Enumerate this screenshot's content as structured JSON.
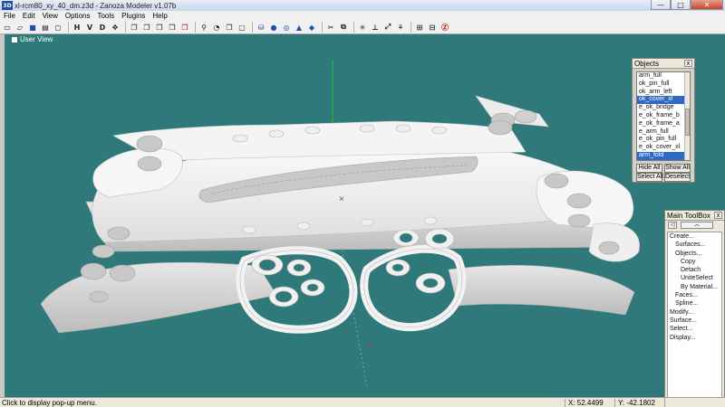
{
  "app": {
    "icon_text": "3D",
    "title": "xl-rcm80_xy_40_dm.z3d - Zanoza Modeler v1.07b",
    "window_controls": {
      "minimize": "—",
      "maximize": "□",
      "close": "✕"
    }
  },
  "menu": [
    "File",
    "Edit",
    "View",
    "Options",
    "Tools",
    "Plugins",
    "Help"
  ],
  "toolbar": {
    "letters": [
      "H",
      "V",
      "D"
    ],
    "icons": [
      "new-icon",
      "open-icon",
      "save-icon",
      "print-icon",
      "hide-icon",
      "view-front-icon",
      "view-side-icon",
      "move-icon",
      "cube-icon",
      "cube-wire-icon",
      "cube-solid-icon",
      "cube-select-icon",
      "zoom-icon",
      "rotate-icon",
      "cube-move-icon",
      "cylinder-icon",
      "sphere-icon",
      "torus-icon",
      "cone-icon",
      "box-blue-icon",
      "cut-icon",
      "light-icon",
      "snap-icon",
      "scale-icon",
      "camera-icon",
      "grid-icon",
      "zanoza-icon"
    ]
  },
  "viewport": {
    "label": "User View",
    "axis_label": "Z"
  },
  "status": {
    "hint": "Click to display pop-up menu.",
    "x": "X: 52.4499",
    "y": "Y: -42.1802"
  },
  "objects_panel": {
    "title": "Objects",
    "close": "x",
    "items": [
      {
        "name": "arm_full",
        "selected": false
      },
      {
        "name": "ok_pin_full",
        "selected": false
      },
      {
        "name": "ok_arm_left",
        "selected": false
      },
      {
        "name": "ok_cover_xl",
        "selected": true
      },
      {
        "name": "e_ok_bridge",
        "selected": false
      },
      {
        "name": "e_ok_frame_b",
        "selected": false
      },
      {
        "name": "e_ok_frame_a",
        "selected": false
      },
      {
        "name": "e_arm_full",
        "selected": false
      },
      {
        "name": "e_ok_pin_full",
        "selected": false
      },
      {
        "name": "e_ok_cover_xl",
        "selected": false
      },
      {
        "name": "arm_fold",
        "selected": true
      }
    ],
    "buttons": {
      "hide_all": "Hide All",
      "show_all": "Show All",
      "select_all": "Select All",
      "deselect": "Deselect"
    }
  },
  "main_toolbox": {
    "title": "Main ToolBox",
    "close": "x",
    "nav_left": "◁",
    "nav_up": "︿",
    "items": [
      {
        "label": "Create...",
        "level": 0
      },
      {
        "label": "Surfaces...",
        "level": 1
      },
      {
        "label": "Objects...",
        "level": 1
      },
      {
        "label": "Copy",
        "level": 2
      },
      {
        "label": "Detach",
        "level": 2
      },
      {
        "label": "UniteSelect",
        "level": 2
      },
      {
        "label": "By Material...",
        "level": 2
      },
      {
        "label": "Faces...",
        "level": 1
      },
      {
        "label": "Spline...",
        "level": 1
      },
      {
        "label": "Modify...",
        "level": 0
      },
      {
        "label": "Surface...",
        "level": 0
      },
      {
        "label": "Select...",
        "level": 0
      },
      {
        "label": "Display...",
        "level": 0
      }
    ]
  },
  "colors": {
    "viewport_bg": "#2f797b",
    "selection": "#316ac5",
    "model": "#f2f2f2"
  }
}
